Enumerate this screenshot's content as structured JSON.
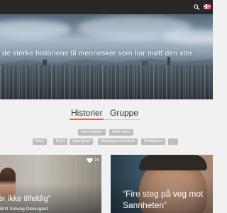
{
  "hero": {
    "tagline": "g de sterke historiene til mennesker som har møtt den ster"
  },
  "tabs": [
    {
      "label": "Historier",
      "active": true
    },
    {
      "label": "Gruppe",
      "active": false
    }
  ],
  "filters": {
    "row1": [
      "Nye historier",
      "With video"
    ],
    "row2": [
      "Barn",
      "Frykt",
      "Kjærlighet",
      "Meningen med livet",
      "Relasjoner",
      "..."
    ]
  },
  "cards": [
    {
      "quote": "er ikke tilfeldig”",
      "author": "Britt Solveig Oleivsgard",
      "likes": "24"
    },
    {
      "quote_line1": "“Fire steg på veg mot",
      "quote_line2": "Sannheten”"
    }
  ],
  "colors": {
    "topbar": "#272727",
    "accent": "#e26a4a",
    "tag": "#bdbdbd",
    "background": "#f1f1f1"
  },
  "icons": {
    "search": "search-icon",
    "flag": "flag-icon",
    "heart": "heart-icon"
  }
}
